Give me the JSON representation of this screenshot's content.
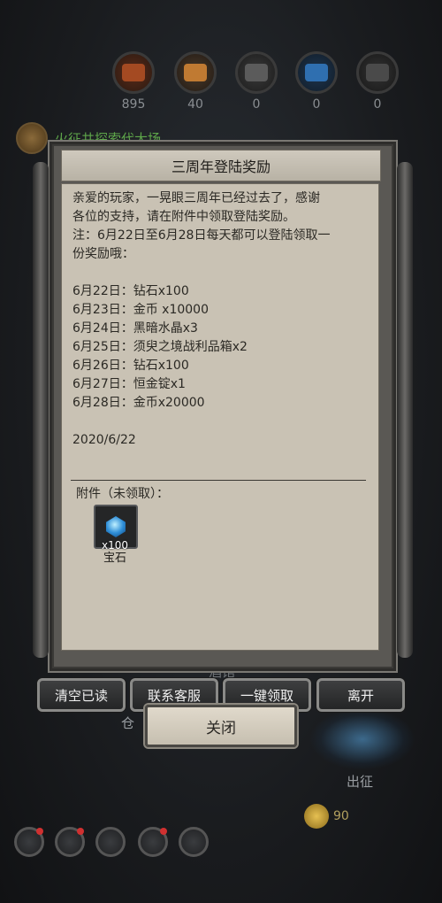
{
  "currencies": [
    {
      "value": "895",
      "icon": "wood-log-icon",
      "color": "#a44a22"
    },
    {
      "value": "40",
      "icon": "plank-icon",
      "color": "#c07a32"
    },
    {
      "value": "0",
      "icon": "iron-icon",
      "color": "#5b5b5b"
    },
    {
      "value": "0",
      "icon": "crystal-icon",
      "color": "#2f6fb0"
    },
    {
      "value": "0",
      "icon": "ore-icon",
      "color": "#4a4a4a"
    }
  ],
  "quest_line": {
    "text": "火征共探索代大场"
  },
  "mail": {
    "title": "三周年登陆奖励",
    "body_lines": [
      "亲爱的玩家，一晃眼三周年已经过去了，感谢",
      "各位的支持，请在附件中领取登陆奖励。",
      "注：6月22日至6月28日每天都可以登陆领取一",
      "份奖励哦：",
      "",
      "6月22日：钻石x100",
      "6月23日：金币 x10000",
      "6月24日：黑暗水晶x3",
      "6月25日：须臾之境战利品箱x2",
      "6月26日：钻石x100",
      "6月27日：恒金锭x1",
      "6月28日：金币x20000",
      "",
      "2020/6/22"
    ],
    "attachment_label": "附件（未领取）：",
    "attachment_item": {
      "count": "x100",
      "name": "宝石",
      "icon": "gem-icon"
    }
  },
  "buttons": {
    "clear_read": "清空已读",
    "contact_support": "联系客服",
    "claim_all": "一键领取",
    "leave": "离开",
    "close": "关闭"
  },
  "background_labels": {
    "warehouse": "仓",
    "depart": "出征",
    "tavern": "酒馆"
  },
  "hud": {
    "coin_value": "90"
  },
  "colors": {
    "accent_green": "#5ea64a",
    "paper": "#c9c2b4"
  }
}
